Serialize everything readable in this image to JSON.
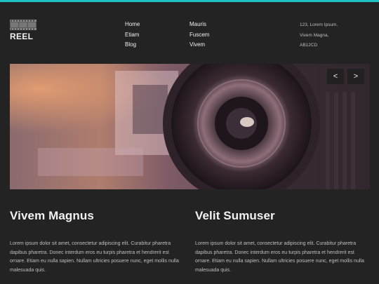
{
  "brand": {
    "name": "REEL",
    "icon": "film-strip-icon"
  },
  "nav": {
    "col1": [
      "Home",
      "Etiam",
      "Blog"
    ],
    "col2": [
      "Mauris",
      "Fuscem",
      "Vivem"
    ]
  },
  "address": [
    "123, Lorem Ipsum.",
    "Vivem Magna,",
    "AB12CD"
  ],
  "slider": {
    "prev_label": "<",
    "next_label": ">"
  },
  "colors": {
    "accent": "#1ec2c4",
    "background": "#232323"
  },
  "columns": [
    {
      "title": "Vivem Magnus",
      "text": "Lorem ipsum dolor sit amet, consectetur adipiscing elit. Curabitur pharetra dapibus pharetra. Donec interdum eros eu turpis pharetra et hendrerit est ornare. Etiam eu nulla sapien. Nullam ultricies posuere nunc, eget mollis nulla malesuada quis."
    },
    {
      "title": "Velit Sumuser",
      "text": "Lorem ipsum dolor sit amet, consectetur adipiscing elit. Curabitur pharetra dapibus pharetra. Donec interdum eros eu turpis pharetra et hendrerit est ornare. Etiam eu nulla sapien. Nullam ultricies posuere nunc, eget mollis nulla malesuada quis."
    }
  ]
}
